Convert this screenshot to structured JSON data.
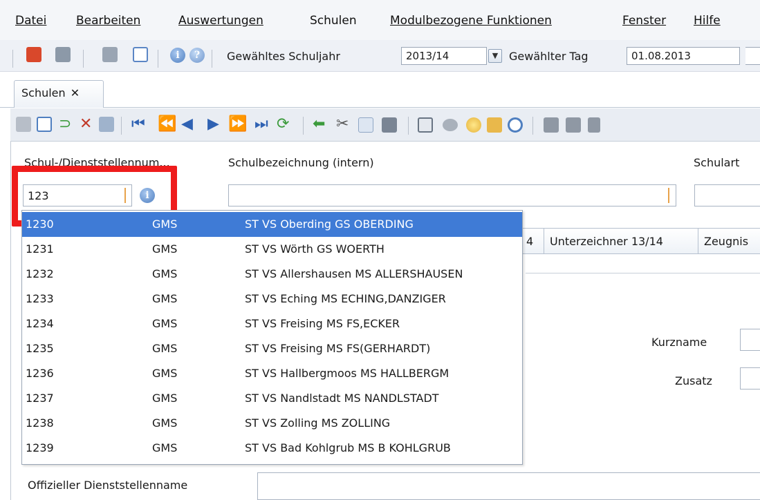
{
  "menu": [
    "Datei",
    "Bearbeiten",
    "Auswertungen",
    "Schulen",
    "Modulbezogene Funktionen",
    "Fenster",
    "Hilfe"
  ],
  "toolbar": {
    "schuljahr_label": "Gewähltes Schuljahr",
    "schuljahr_value": "2013/14",
    "tag_label": "Gewählter Tag",
    "tag_value": "01.08.2013"
  },
  "tabs": {
    "active": "Schulen",
    "close_glyph": "✕"
  },
  "form": {
    "nummer_label": "Schul-/Dienststellennum...",
    "nummer_value": "123",
    "bezeichnung_label": "Schulbezeichnung (intern)",
    "schulart_label": "Schulart",
    "kurzname_label": "Kurzname",
    "zusatz_label": "Zusatz",
    "offiziell_label": "Offizieller Dienststellenname"
  },
  "subtabs": {
    "partial": "4",
    "unterzeichner": "Unterzeichner 13/14",
    "zeugnis": "Zeugnis"
  },
  "dropdown": {
    "rows": [
      {
        "nr": "1230",
        "art": "GMS",
        "name": "ST VS Oberding GS OBERDING",
        "selected": true
      },
      {
        "nr": "1231",
        "art": "GMS",
        "name": "ST VS Wörth GS WOERTH"
      },
      {
        "nr": "1232",
        "art": "GMS",
        "name": "ST VS Allershausen MS ALLERSHAUSEN"
      },
      {
        "nr": "1233",
        "art": "GMS",
        "name": "ST VS Eching MS ECHING,DANZIGER"
      },
      {
        "nr": "1234",
        "art": "GMS",
        "name": "ST VS Freising MS FS,ECKER"
      },
      {
        "nr": "1235",
        "art": "GMS",
        "name": "ST VS Freising MS FS(GERHARDT)"
      },
      {
        "nr": "1236",
        "art": "GMS",
        "name": "ST VS Hallbergmoos MS HALLBERGM"
      },
      {
        "nr": "1237",
        "art": "GMS",
        "name": "ST VS Nandlstadt MS NANDLSTADT"
      },
      {
        "nr": "1238",
        "art": "GMS",
        "name": "ST VS Zolling MS ZOLLING"
      },
      {
        "nr": "1239",
        "art": "GMS",
        "name": "ST VS Bad Kohlgrub MS B KOHLGRUB"
      }
    ]
  },
  "colors": {
    "selection": "#3f7bd6",
    "highlight_box": "#ee1c1c",
    "caret": "#e8a24a"
  }
}
